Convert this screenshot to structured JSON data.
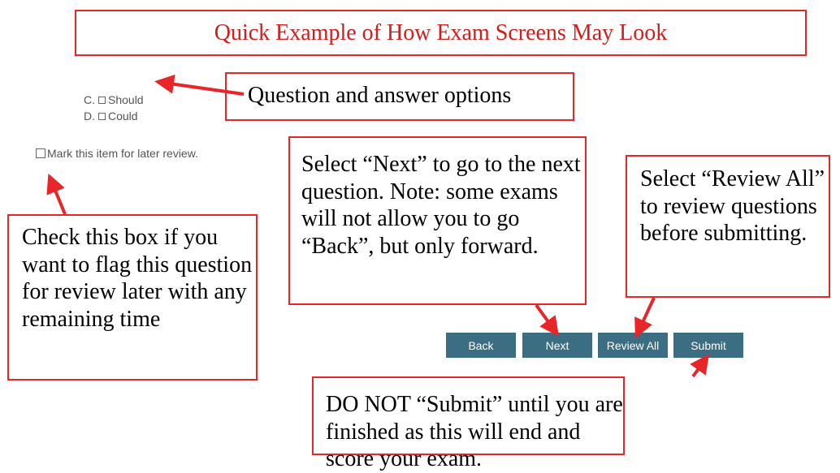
{
  "title": "Quick Example of How Exam Screens May Look",
  "question": {
    "options": [
      {
        "letter": "C.",
        "text": "Should"
      },
      {
        "letter": "D.",
        "text": "Could"
      }
    ],
    "mark_for_review": "Mark this item for later review."
  },
  "callouts": {
    "question_answer": "Question and answer options",
    "next": "Select “Next” to go to the next question.  Note: some exams will not allow you to go “Back”, but only forward.",
    "review_all": "Select “Review All” to review questions before submitting.",
    "flag": "Check this box if you want to flag this question for review later with any remaining time",
    "submit": "DO NOT “Submit” until you are finished as this will end and score your exam."
  },
  "buttons": {
    "back": "Back",
    "next": "Next",
    "review_all": "Review All",
    "submit": "Submit"
  },
  "colors": {
    "accent_red": "#e8262a",
    "title_red": "#d51c1c",
    "button_teal": "#3b6e82"
  }
}
